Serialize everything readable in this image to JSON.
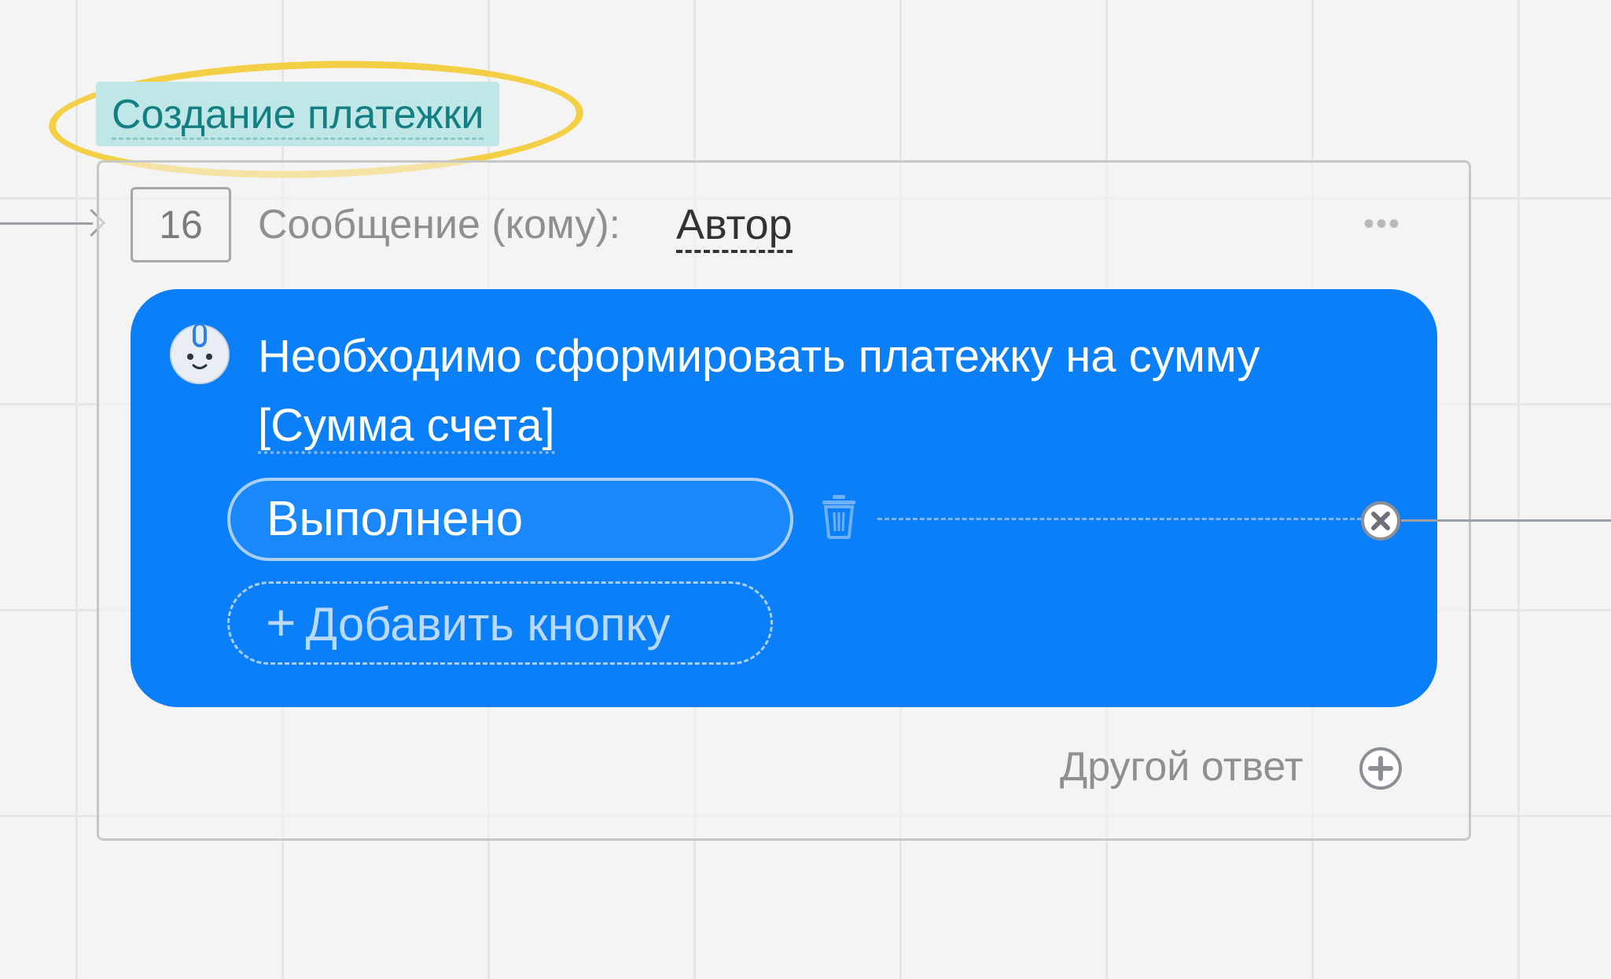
{
  "step": {
    "title": "Создание платежки",
    "number": "16"
  },
  "message": {
    "label": "Сообщение (кому):",
    "recipient": "Автор",
    "text_before": "Необходимо сформировать платежку на сумму ",
    "variable": "[Сумма счета]"
  },
  "buttons": {
    "done_label": "Выполнено",
    "add_plus": "+",
    "add_label": "Добавить кнопку"
  },
  "footer": {
    "other_answer_label": "Другой ответ"
  },
  "colors": {
    "bubble": "#0b7ff8",
    "highlight": "#f3cf45",
    "title_bg": "#bfe7e7",
    "title_text": "#147f82"
  },
  "icons": {
    "avatar": "bot-avatar-icon",
    "trash": "trash-icon",
    "close": "close-circle-icon",
    "add": "plus-circle-icon",
    "more": "more-dots-icon",
    "arrow": "arrow-right-icon"
  }
}
